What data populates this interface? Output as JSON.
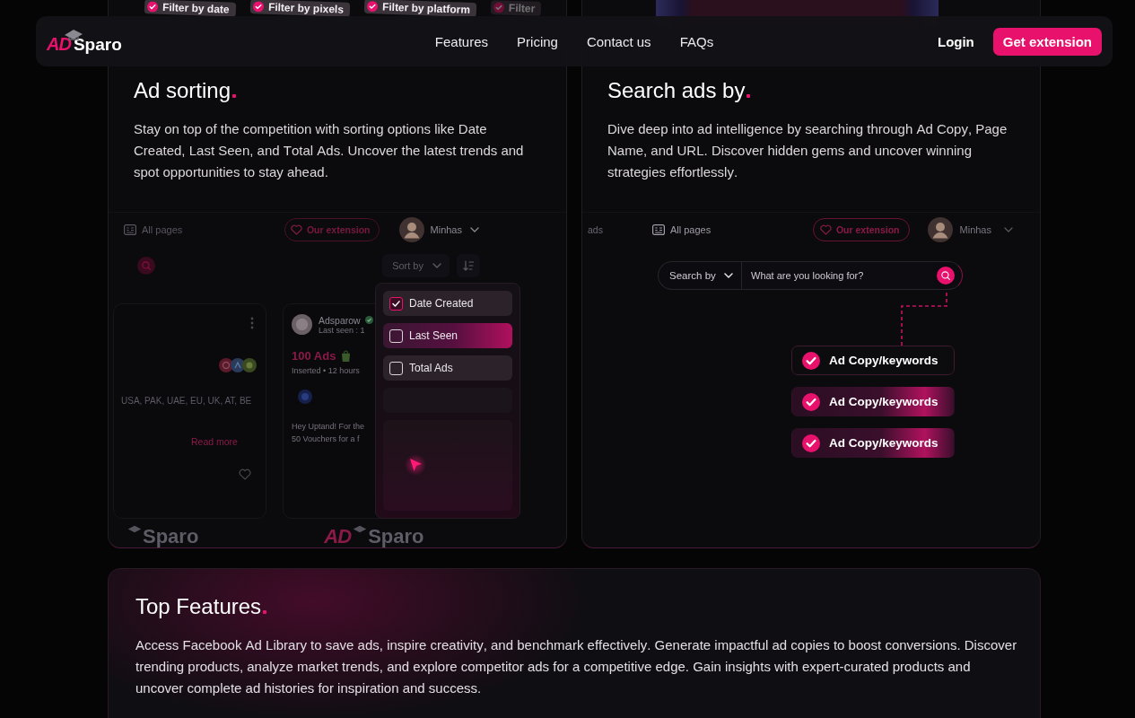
{
  "top_strip": {
    "chips": [
      {
        "label": "Filter by date"
      },
      {
        "label": "Filter by pixels"
      },
      {
        "label": "Filter by platform"
      },
      {
        "label": "Filter"
      }
    ]
  },
  "nav": {
    "logo_mark": "AD",
    "logo_name": "Sparo",
    "links": [
      "Features",
      "Pricing",
      "Contact us",
      "FAQs"
    ],
    "login": "Login",
    "cta": "Get extension"
  },
  "sorting_card": {
    "title": "Ad sorting",
    "description": "Stay on top of the competition with sorting options like Date Created, Last Seen, and Total Ads. Uncover the latest trends and spot opportunities to stay ahead.",
    "mockup": {
      "pages": "All pages",
      "extension": "Our extension",
      "user": "Minhas",
      "sort_label": "Sort by",
      "left_ad": {
        "countries": "USA, PAK, UAE, EU, UK, AT, BE",
        "read_more": "Read more"
      },
      "middle_ad": {
        "name": "Adsparow",
        "last_seen": "Last seen : 1",
        "count": "100 Ads",
        "inserted": "Inserted • 12 hours",
        "text_lines": [
          "Hey Uptand! For the",
          "50 Vouchers for a f"
        ]
      },
      "sort_options": [
        {
          "label": "Date Created",
          "checked": true,
          "selected": false
        },
        {
          "label": "Last Seen",
          "checked": false,
          "selected": true
        },
        {
          "label": "Total Ads",
          "checked": false,
          "selected": false
        }
      ],
      "logos": [
        {
          "name": "Sparo"
        },
        {
          "mark": "AD",
          "name": "Sparo"
        }
      ]
    }
  },
  "search_card": {
    "title": "Search ads by",
    "description": "Dive deep into ad intelligence by searching through Ad Copy, Page Name, and URL. Discover hidden gems and uncover winning strategies effortlessly.",
    "mockup": {
      "side_label": "ads",
      "pages": "All pages",
      "extension": "Our extension",
      "user": "Minhas",
      "search": {
        "filter_label": "Search by",
        "placeholder": "What are you looking for?"
      },
      "options": [
        {
          "label": "Ad Copy/keywords",
          "selected": false
        },
        {
          "label": "Ad Copy/keywords",
          "selected": true
        },
        {
          "label": "Ad Copy/keywords",
          "selected": true
        }
      ]
    }
  },
  "features_card": {
    "title": "Top Features",
    "description": "Access Facebook Ad Library to save ads, inspire creativity, and benchmark effectively. Generate impactful ad copies to boost conversions. Discover trending products, analyze market trends, and explore competitor ads for a competitive edge. Gain insights with expert-curated products and uncover complete ad histories for inspiration and success."
  }
}
